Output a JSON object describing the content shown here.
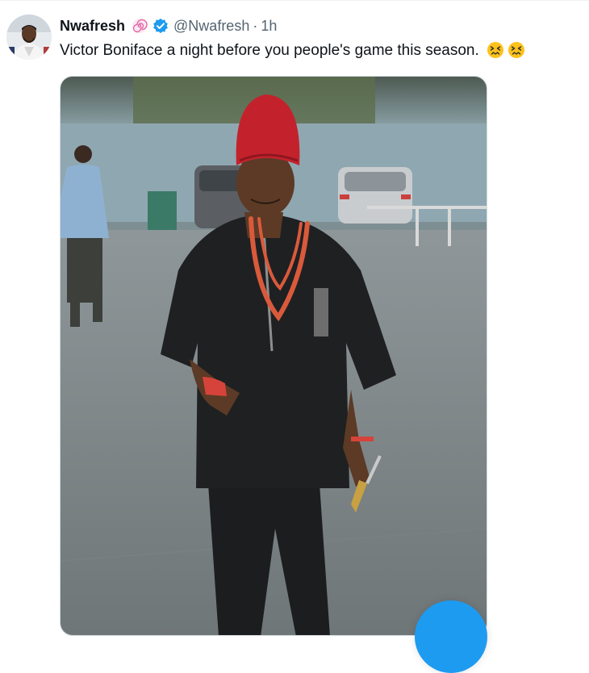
{
  "tweet": {
    "display_name": "Nwafresh",
    "handle": "@Nwafresh",
    "separator": "·",
    "time": "1h",
    "text": "Victor Boniface a night before you people's game this season.",
    "emojis": [
      "confounded-face-icon",
      "confounded-face-icon"
    ]
  },
  "icons": {
    "spiral": "spiral-icon",
    "verified": "verified-badge-icon"
  },
  "colors": {
    "accent": "#1d9bf0",
    "handle": "#536471",
    "text": "#0f1419",
    "spiral": "#e36aa8"
  }
}
